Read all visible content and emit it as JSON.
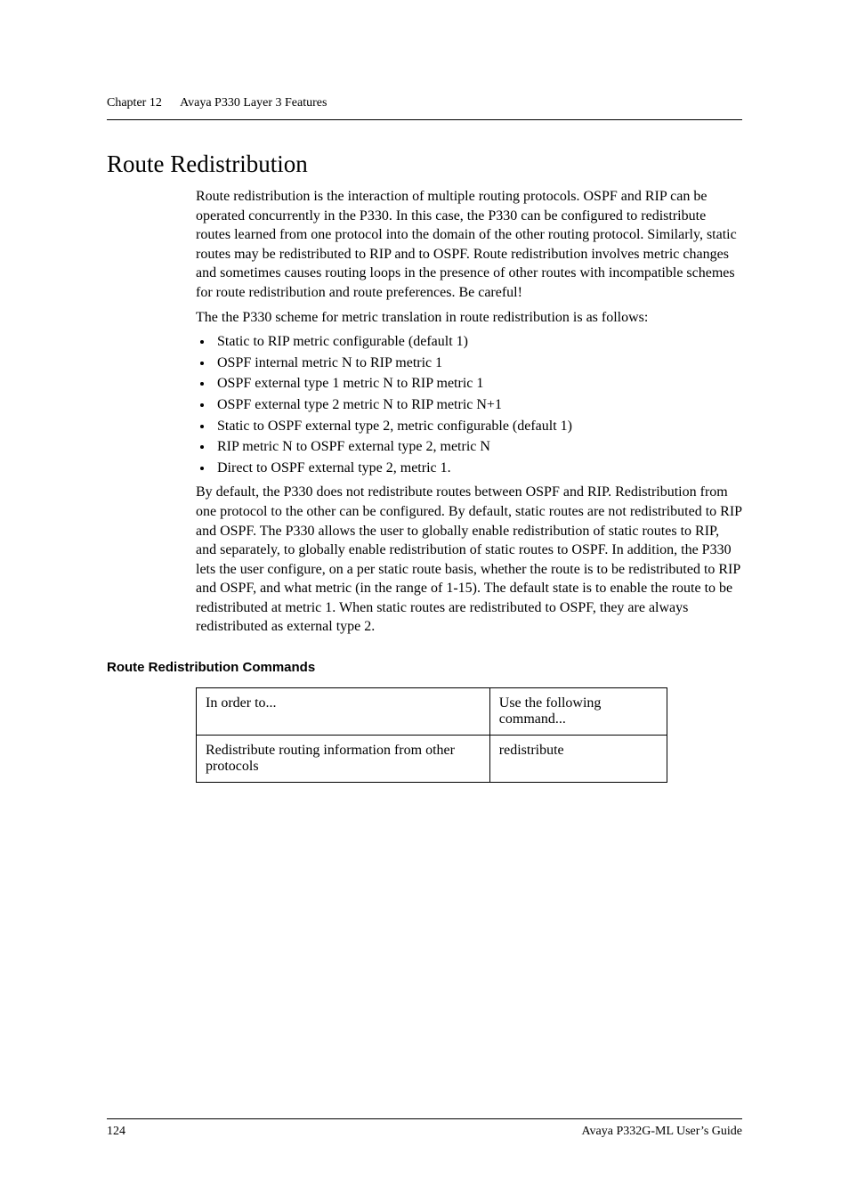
{
  "header": {
    "chapter_label": "Chapter 12",
    "chapter_title": "Avaya P330 Layer 3 Features"
  },
  "section": {
    "title": "Route Redistribution",
    "para1": "Route redistribution is the interaction of multiple routing protocols. OSPF and RIP can be operated concurrently in the P330. In this case, the P330 can be configured to redistribute routes learned from one protocol into the domain of the other routing protocol. Similarly, static routes may be redistributed to RIP and to OSPF. Route redistribution involves metric changes and sometimes causes routing loops in the presence of other routes with incompatible schemes for route redistribution and route preferences. Be careful!",
    "para2": "The the P330 scheme for metric translation in route redistribution is as follows:",
    "bullets": [
      "Static to RIP metric configurable (default 1)",
      "OSPF internal metric N to RIP metric 1",
      "OSPF external type 1 metric N to RIP metric 1",
      "OSPF external type 2 metric N to RIP metric N+1",
      "Static to OSPF external type 2, metric configurable (default 1)",
      "RIP metric N to OSPF external type 2, metric N",
      "Direct to OSPF external type 2, metric 1."
    ],
    "para3": "By default, the P330 does not redistribute routes between OSPF and RIP. Redistribution from one protocol to the other can be configured. By default, static routes are not redistributed to RIP and OSPF. The P330 allows the user to globally enable redistribution of static routes to RIP, and separately, to globally enable redistribution of static routes to OSPF. In addition, the P330 lets the user configure, on a per static route basis, whether the route is to be redistributed to RIP and OSPF, and what metric (in the range of 1-15). The default state is to enable the route to be redistributed at metric 1. When static routes are redistributed to OSPF, they are always redistributed as external type 2."
  },
  "commands": {
    "heading": "Route Redistribution Commands",
    "table": {
      "head_left": "In order to...",
      "head_right": "Use the following command...",
      "row_left": "Redistribute routing information from other protocols",
      "row_right": "redistribute"
    }
  },
  "footer": {
    "page": "124",
    "doc": "Avaya P332G-ML User’s Guide"
  }
}
